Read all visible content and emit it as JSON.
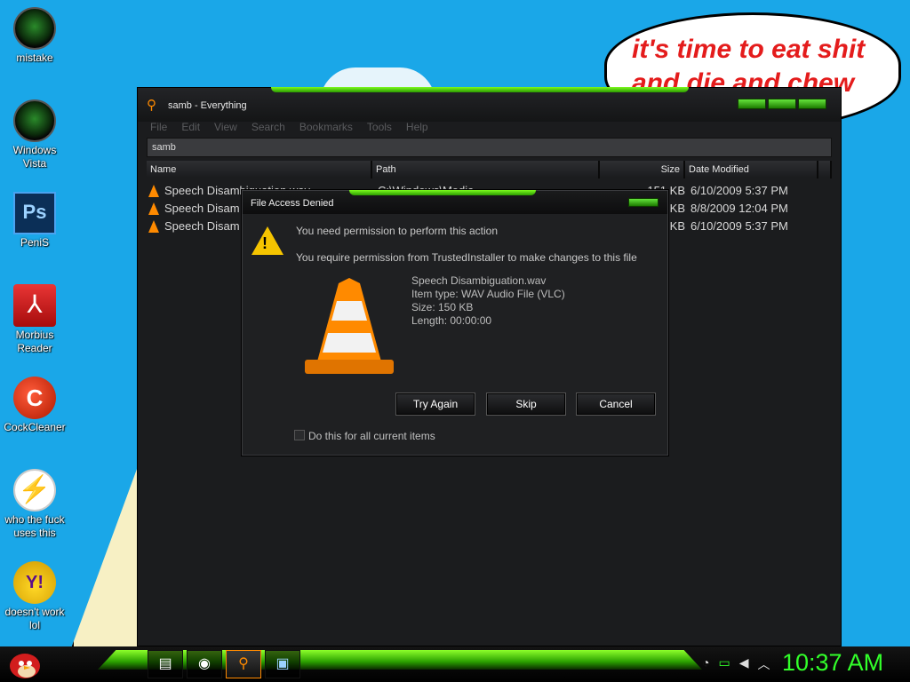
{
  "desktop": {
    "bubble_text": "it's time to eat shit and die and chew",
    "icons": [
      {
        "label": "mistake",
        "icon": "orb-icon"
      },
      {
        "label": "Windows Vista",
        "icon": "orb-icon"
      },
      {
        "label": "PeniS",
        "glyph": "Ps",
        "icon": "photoshop-icon"
      },
      {
        "label": "Morbius Reader",
        "glyph": "⅄",
        "icon": "pdf-reader-icon"
      },
      {
        "label": "CockCleaner",
        "glyph": "C",
        "icon": "ccleaner-icon"
      },
      {
        "label": "who the fuck uses this",
        "glyph": "⚡",
        "icon": "avast-icon"
      },
      {
        "label": "doesn't work lol",
        "glyph": "Y!",
        "icon": "yahoo-messenger-icon"
      }
    ]
  },
  "window": {
    "title": "samb - Everything",
    "menu": [
      "File",
      "Edit",
      "View",
      "Search",
      "Bookmarks",
      "Tools",
      "Help"
    ],
    "search_value": "samb",
    "columns": {
      "name": "Name",
      "path": "Path",
      "size": "Size",
      "date": "Date Modified"
    },
    "rows": [
      {
        "name": "Speech Disambiguation.wav",
        "path": "C:\\Windows\\Media",
        "size": "151 KB",
        "date": "6/10/2009 5:37 PM"
      },
      {
        "name": "Speech Disam",
        "path": "",
        "size": "KB",
        "date": "8/8/2009 12:04 PM"
      },
      {
        "name": "Speech Disam",
        "path": "",
        "size": "KB",
        "date": "6/10/2009 5:37 PM"
      }
    ]
  },
  "dialog": {
    "title": "File Access Denied",
    "message1": "You need permission to perform this action",
    "message2": "You require permission from TrustedInstaller to make changes to this file",
    "file_name": "Speech Disambiguation.wav",
    "item_type": "Item type: WAV Audio File (VLC)",
    "size": "Size: 150 KB",
    "length": "Length: 00:00:00",
    "buttons": {
      "try_again": "Try Again",
      "skip": "Skip",
      "cancel": "Cancel"
    },
    "checkbox_label": "Do this for all current items"
  },
  "taskbar": {
    "clock": "10:37 AM",
    "tray_icons": [
      "clock-arrow-icon",
      "network-icon",
      "volume-icon",
      "chevron-icon"
    ],
    "apps": [
      "folder-icon",
      "chrome-icon",
      "everything-icon",
      "photoshop-icon"
    ]
  },
  "colors": {
    "accent_green": "#32ff2a",
    "desktop_bg": "#1aa7e8",
    "brand_orange": "#ff8a00"
  }
}
